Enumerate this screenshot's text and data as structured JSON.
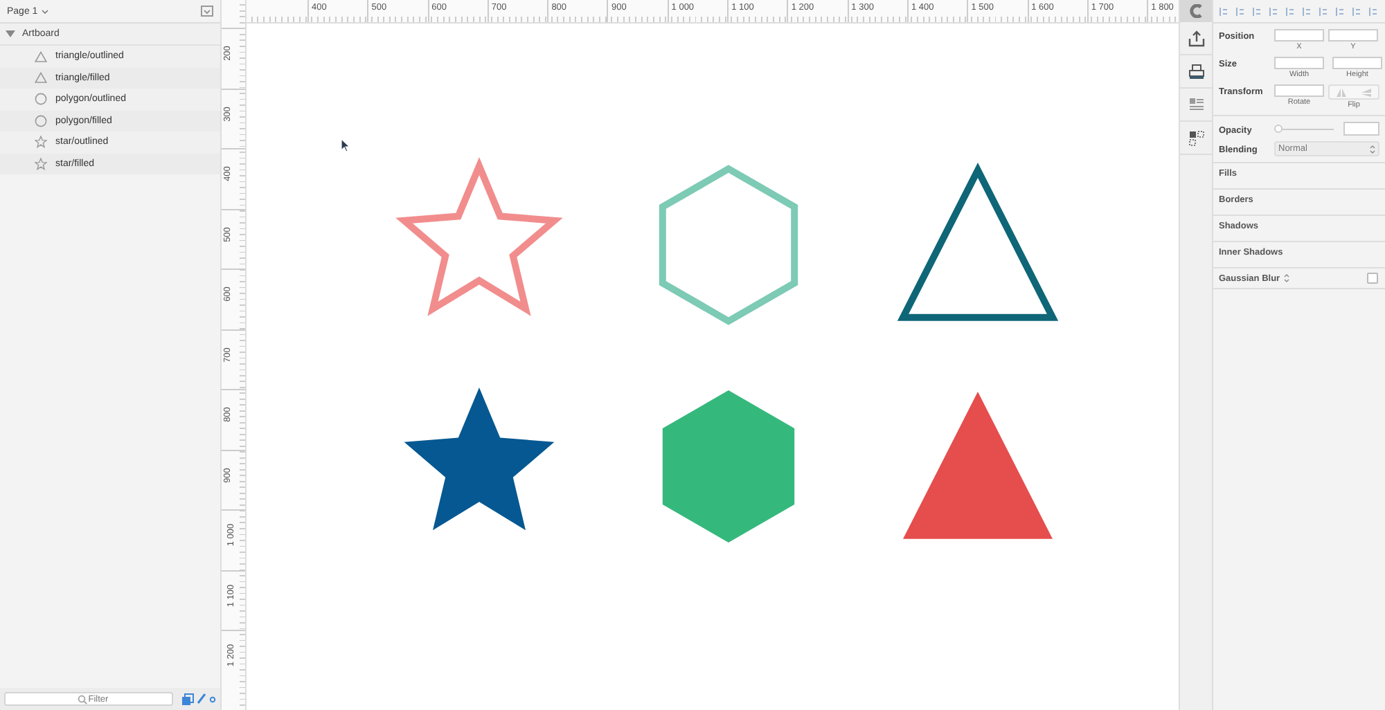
{
  "page": {
    "title": "Page 1"
  },
  "layers": {
    "group": {
      "label": "Artboard",
      "expanded": true
    },
    "items": [
      {
        "label": "triangle/outlined",
        "kind": "triangle"
      },
      {
        "label": "triangle/filled",
        "kind": "triangle"
      },
      {
        "label": "polygon/outlined",
        "kind": "polygon"
      },
      {
        "label": "polygon/filled",
        "kind": "polygon"
      },
      {
        "label": "star/outlined",
        "kind": "star"
      },
      {
        "label": "star/filled",
        "kind": "star"
      }
    ]
  },
  "filter": {
    "placeholder": "Filter"
  },
  "horizontal_ruler": [
    "400",
    "500",
    "600",
    "700",
    "800",
    "900",
    "1 000",
    "1 100",
    "1 200",
    "1 300",
    "1 400",
    "1 500",
    "1 600",
    "1 700",
    "1 800"
  ],
  "vertical_ruler": [
    "200",
    "300",
    "400",
    "500",
    "600",
    "700",
    "800",
    "900",
    "1 000",
    "1 100",
    "1 200"
  ],
  "shapes": [
    {
      "kind": "star",
      "filled": false,
      "color": "#f28d8d"
    },
    {
      "kind": "hexagon",
      "filled": false,
      "color": "#7dcab5"
    },
    {
      "kind": "triangle",
      "filled": false,
      "color": "#0e6677"
    },
    {
      "kind": "star",
      "filled": true,
      "color": "#055891"
    },
    {
      "kind": "hexagon",
      "filled": true,
      "color": "#35b87c"
    },
    {
      "kind": "triangle",
      "filled": true,
      "color": "#e64d4d"
    }
  ],
  "inspector": {
    "position": {
      "label": "Position",
      "fields": [
        "X",
        "Y"
      ]
    },
    "size": {
      "label": "Size",
      "fields": [
        "Width",
        "Height"
      ]
    },
    "transform": {
      "label": "Transform",
      "rotate": "Rotate",
      "flip": "Flip"
    },
    "opacity": {
      "label": "Opacity",
      "level": 0
    },
    "blending": {
      "label": "Blending",
      "value": "Normal"
    },
    "sections": [
      "Fills",
      "Borders",
      "Shadows",
      "Inner Shadows"
    ],
    "blur": {
      "label": "Gaussian Blur",
      "checked": false
    }
  }
}
